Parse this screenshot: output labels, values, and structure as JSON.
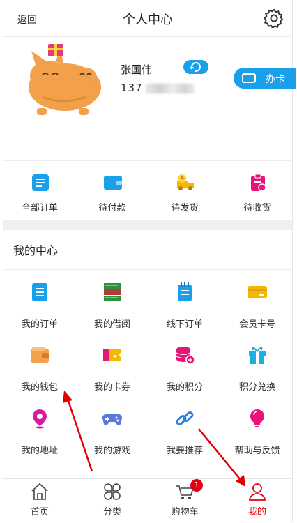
{
  "header": {
    "back_label": "返回",
    "title": "个人中心",
    "settings_icon": "gear-icon"
  },
  "profile": {
    "name": "张国伟",
    "phone_visible": "137",
    "card_button_label": "办卡",
    "accent": "#1aa0ea"
  },
  "orders": [
    {
      "label": "全部订单",
      "icon": "document-icon",
      "color": "#1aa0ea"
    },
    {
      "label": "待付款",
      "icon": "wallet-icon",
      "color": "#1aa0ea"
    },
    {
      "label": "待发货",
      "icon": "truck-icon",
      "color": "#f5b800"
    },
    {
      "label": "待收货",
      "icon": "clipboard-icon",
      "color": "#e6157a"
    }
  ],
  "center": {
    "title": "我的中心",
    "items": [
      {
        "label": "我的订单",
        "icon": "order-list-icon"
      },
      {
        "label": "我的借阅",
        "icon": "books-icon"
      },
      {
        "label": "线下订单",
        "icon": "notepad-icon"
      },
      {
        "label": "会员卡号",
        "icon": "member-card-icon"
      },
      {
        "label": "我的钱包",
        "icon": "wallet-icon"
      },
      {
        "label": "我的卡券",
        "icon": "coupon-icon"
      },
      {
        "label": "我的积分",
        "icon": "coins-icon"
      },
      {
        "label": "积分兑换",
        "icon": "gift-icon"
      },
      {
        "label": "我的地址",
        "icon": "location-icon"
      },
      {
        "label": "我的游戏",
        "icon": "gamepad-icon"
      },
      {
        "label": "我要推荐",
        "icon": "link-icon"
      },
      {
        "label": "帮助与反馈",
        "icon": "lightbulb-icon"
      }
    ]
  },
  "tabbar": {
    "items": [
      {
        "label": "首页",
        "icon": "home-icon"
      },
      {
        "label": "分类",
        "icon": "category-icon"
      },
      {
        "label": "购物车",
        "icon": "cart-icon",
        "badge": "1"
      },
      {
        "label": "我的",
        "icon": "user-icon",
        "active": true
      }
    ],
    "active_color": "#e40012"
  }
}
